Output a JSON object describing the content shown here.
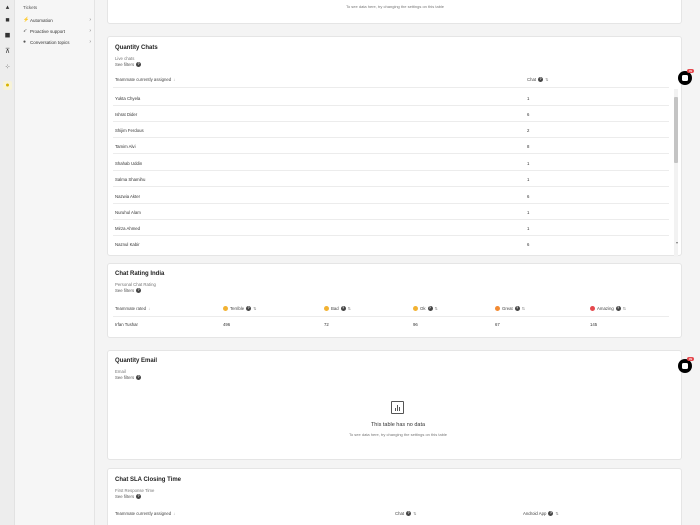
{
  "sidebar": {
    "icons": [
      "chart-icon",
      "inbox-icon",
      "box-icon",
      "cart-icon",
      "grid-icon",
      "bulb-icon"
    ]
  },
  "subnav": {
    "heading": "Tickets",
    "items": [
      {
        "label": "Automation",
        "icon": "bolt-icon"
      },
      {
        "label": "Proactive support",
        "icon": "rocket-icon"
      },
      {
        "label": "Conversation topics",
        "icon": "pin-icon"
      }
    ]
  },
  "top_card": {
    "empty_sub": "To see data here, try changing the settings on this table"
  },
  "quantity_chats": {
    "title": "Quantity Chats",
    "subtitle": "Live chats",
    "filter": "See filters",
    "col_teammate": "Teammate currently assigned",
    "col_chat": "Chat",
    "rows": [
      {
        "name": "Yukta Chyela",
        "value": "1"
      },
      {
        "name": "Ishrat Dider",
        "value": "6"
      },
      {
        "name": "Shijim Ferdous",
        "value": "2"
      },
      {
        "name": "Tamim Alvi",
        "value": "8"
      },
      {
        "name": "Shahab Uddin",
        "value": "1"
      },
      {
        "name": "Salma Shamihu",
        "value": "1"
      },
      {
        "name": "Nazwia Akter",
        "value": "6"
      },
      {
        "name": "Nuruhul Alam",
        "value": "1"
      },
      {
        "name": "Mirza Ahmed",
        "value": "1"
      },
      {
        "name": "Naznul Kabir",
        "value": "6"
      }
    ]
  },
  "chat_rating": {
    "title": "Chat Rating India",
    "subtitle": "Personal Chat Rating",
    "filter": "See filters",
    "col_teammate": "Teammate rated",
    "cols": [
      "Terrible",
      "Bad",
      "Ok",
      "Great",
      "Amazing"
    ],
    "emoji_colors": [
      "#f2b233",
      "#f2b233",
      "#f2b233",
      "#f28a33",
      "#e5484d"
    ],
    "row": {
      "name": "Irfan Tushar",
      "values": [
        "496",
        "72",
        "96",
        "67",
        "145"
      ]
    }
  },
  "quantity_email": {
    "title": "Quantity Email",
    "subtitle": "Email",
    "filter": "See filters",
    "empty_title": "This table has no data",
    "empty_sub": "To see data here, try changing the settings on this table"
  },
  "sla": {
    "title": "Chat SLA Closing Time",
    "subtitle": "First Response Time",
    "filter": "See filters",
    "col_teammate": "Teammate currently assigned",
    "col_chat": "Chat",
    "col_android": "Android App"
  },
  "chat_widget": {
    "badge": "99"
  }
}
